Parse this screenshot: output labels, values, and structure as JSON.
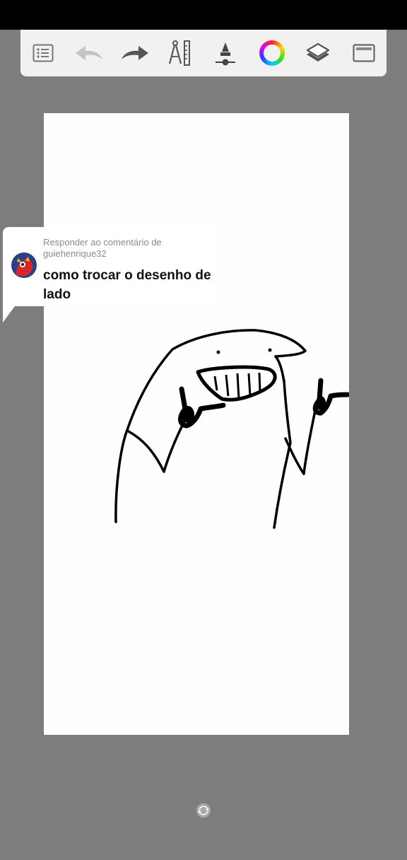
{
  "app": {
    "name": "drawing-app"
  },
  "toolbar": {
    "items": [
      {
        "name": "menu",
        "icon": "list-icon"
      },
      {
        "name": "undo",
        "icon": "undo-arrow-icon"
      },
      {
        "name": "redo",
        "icon": "redo-arrow-icon"
      },
      {
        "name": "ruler",
        "icon": "compass-ruler-icon"
      },
      {
        "name": "brush",
        "icon": "brush-size-icon"
      },
      {
        "name": "color",
        "icon": "color-wheel-icon"
      },
      {
        "name": "layers",
        "icon": "layers-icon"
      },
      {
        "name": "fullscreen",
        "icon": "fullscreen-icon"
      }
    ]
  },
  "comment": {
    "reply_header": "Responder ao comentário de guiehenrique32",
    "text": "como trocar o desenho de lado"
  },
  "colors": {
    "background": "#7d7e7c",
    "toolbar": "#f1f1f1",
    "canvas": "#fefefe",
    "ink": "#000000"
  }
}
